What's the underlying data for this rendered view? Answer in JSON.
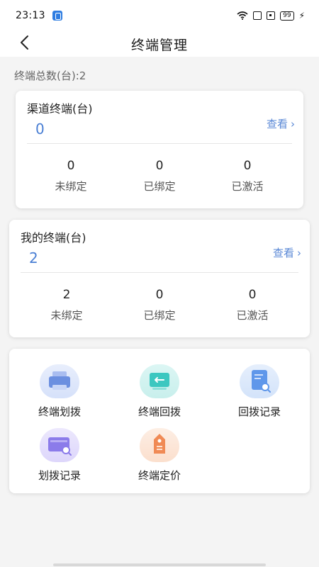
{
  "status_bar": {
    "time": "23:13",
    "battery": "99"
  },
  "header": {
    "title": "终端管理"
  },
  "summary": {
    "total_label": "终端总数(台):2"
  },
  "channel_card": {
    "title": "渠道终端(台)",
    "count": "0",
    "view_label": "查看",
    "stats": [
      {
        "value": "0",
        "label": "未绑定"
      },
      {
        "value": "0",
        "label": "已绑定"
      },
      {
        "value": "0",
        "label": "已激活"
      }
    ]
  },
  "my_card": {
    "title": "我的终端(台)",
    "count": "2",
    "view_label": "查看",
    "stats": [
      {
        "value": "2",
        "label": "未绑定"
      },
      {
        "value": "0",
        "label": "已绑定"
      },
      {
        "value": "0",
        "label": "已激活"
      }
    ]
  },
  "actions": [
    {
      "label": "终端划拨",
      "icon": "printer-icon",
      "color": "#6b8fe0"
    },
    {
      "label": "终端回拨",
      "icon": "return-icon",
      "color": "#3cc7c0"
    },
    {
      "label": "回拨记录",
      "icon": "record-search-icon",
      "color": "#5f97ea"
    },
    {
      "label": "划拨记录",
      "icon": "card-search-icon",
      "color": "#8b7bea"
    },
    {
      "label": "终端定价",
      "icon": "price-tag-icon",
      "color": "#f08a55"
    }
  ],
  "colors": {
    "accent_blue": "#4a7fd4",
    "link_blue": "#5a88d6"
  }
}
